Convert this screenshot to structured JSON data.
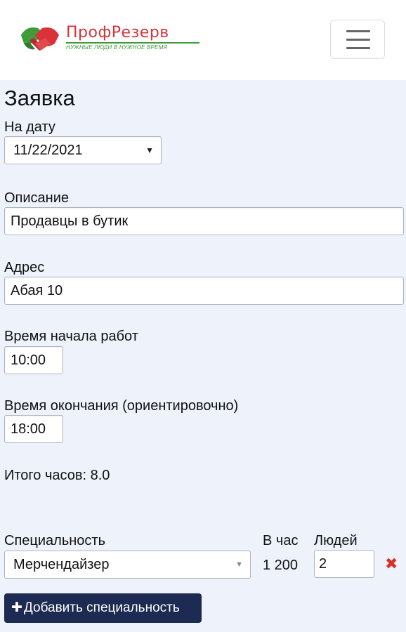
{
  "header": {
    "logo_name": "ПрофРезерв",
    "logo_tagline": "НУЖНЫЕ ЛЮДИ В НУЖНОЕ ВРЕМЯ",
    "menu_icon": "hamburger-menu-icon"
  },
  "form": {
    "title": "Заявка",
    "date_label": "На дату",
    "date_value": "11/22/2021",
    "description_label": "Описание",
    "description_value": "Продавцы в бутик",
    "address_label": "Адрес",
    "address_value": "Абая 10",
    "start_label": "Время начала работ",
    "start_value": "10:00",
    "end_label": "Время окончания (ориентировочно)",
    "end_value": "18:00",
    "total_hours": "Итого часов: 8.0"
  },
  "specialties": {
    "col_specialty": "Специальность",
    "col_rate": "В час",
    "col_people": "Людей",
    "rows": [
      {
        "specialty": "Мерчендайзер",
        "rate": "1 200",
        "people": "2"
      }
    ],
    "add_button_label": "Добавить специальность",
    "add_icon": "plus-icon",
    "remove_icon": "close-icon"
  },
  "colors": {
    "brand_red": "#d9323a",
    "brand_green": "#3f9b3b",
    "button_navy": "#1d2a52",
    "remove_red": "#d93025",
    "page_background": "#edf2fb"
  }
}
